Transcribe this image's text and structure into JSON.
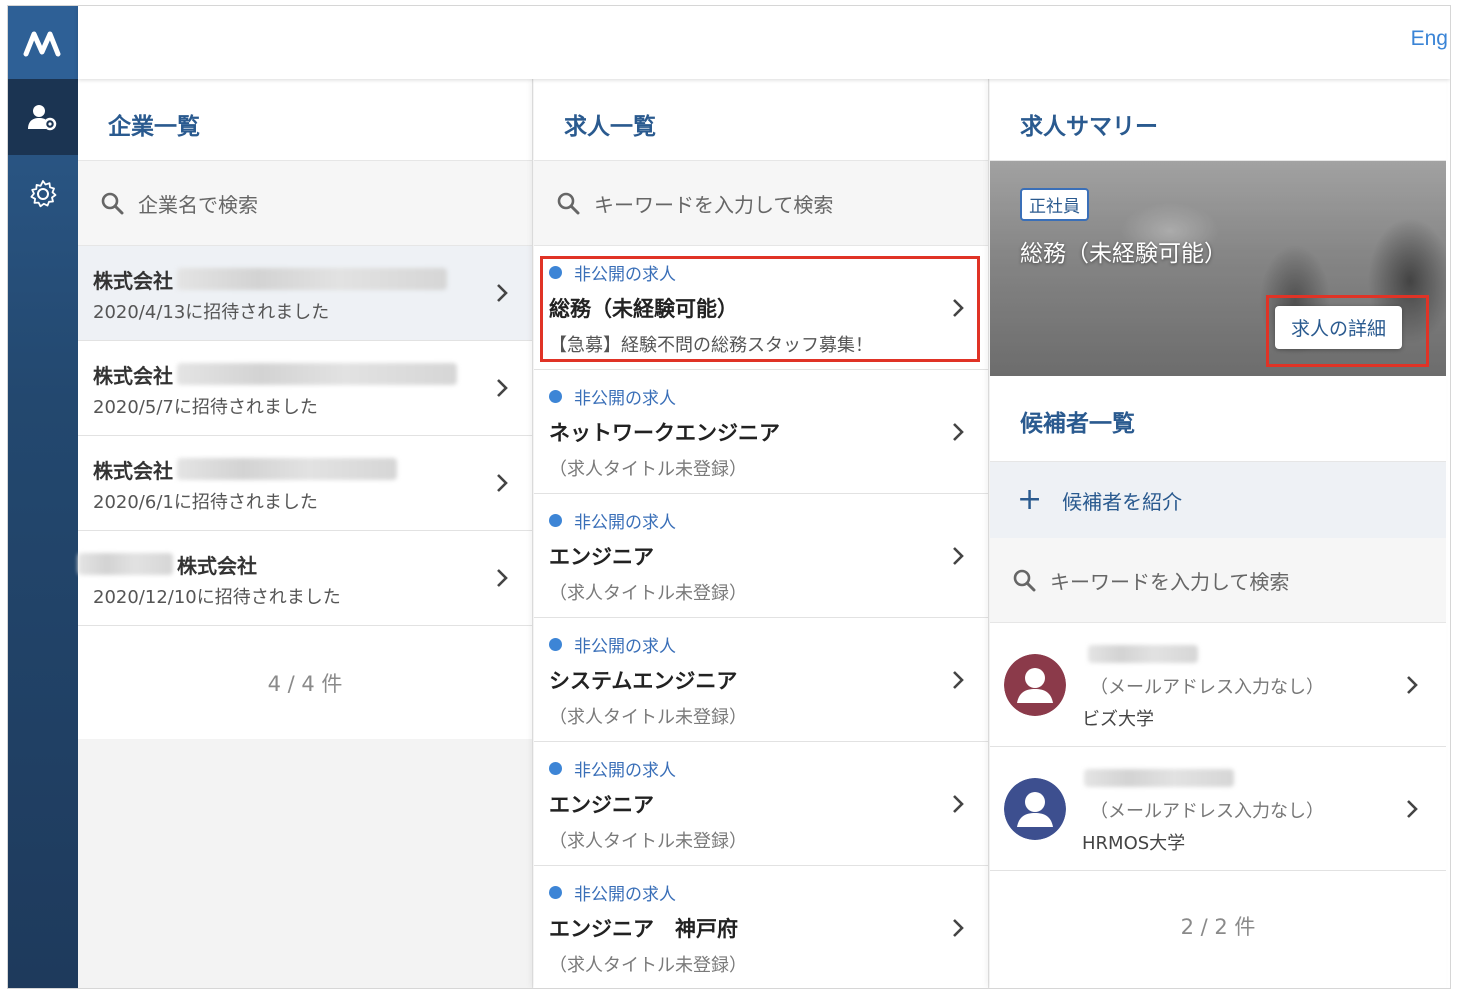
{
  "header": {
    "language_toggle": "Eng"
  },
  "nav": {
    "logo_icon": "brand-logo-icon",
    "items": [
      {
        "icon": "user-settings-icon",
        "active": true
      },
      {
        "icon": "gear-icon",
        "active": false
      }
    ]
  },
  "companies": {
    "title": "企業一覧",
    "search_placeholder": "企業名で検索",
    "items": [
      {
        "name": "株式会社",
        "date": "2020/4/13に招待されました"
      },
      {
        "name": "株式会社",
        "date": "2020/5/7に招待されました"
      },
      {
        "name": "株式会社",
        "date": "2020/6/1に招待されました"
      },
      {
        "name": "株式会社",
        "date": "2020/12/10に招待されました"
      }
    ],
    "count": "4 / 4 件"
  },
  "jobs": {
    "title": "求人一覧",
    "search_placeholder": "キーワードを入力して検索",
    "items": [
      {
        "status": "非公開の求人",
        "title": "総務（未経験可能）",
        "subtitle": "【急募】経験不問の総務スタッフ募集！"
      },
      {
        "status": "非公開の求人",
        "title": "ネットワークエンジニア",
        "subtitle": "（求人タイトル未登録）"
      },
      {
        "status": "非公開の求人",
        "title": "エンジニア",
        "subtitle": "（求人タイトル未登録）"
      },
      {
        "status": "非公開の求人",
        "title": "システムエンジニア",
        "subtitle": "（求人タイトル未登録）"
      },
      {
        "status": "非公開の求人",
        "title": "エンジニア",
        "subtitle": "（求人タイトル未登録）"
      },
      {
        "status": "非公開の求人",
        "title": "エンジニア　神戸府",
        "subtitle": "（求人タイトル未登録）"
      }
    ]
  },
  "summary": {
    "title": "求人サマリー",
    "employment_type": "正社員",
    "job_title": "総務（未経験可能）",
    "detail_button": "求人の詳細"
  },
  "candidates": {
    "title": "候補者一覧",
    "add_label": "候補者を紹介",
    "search_placeholder": "キーワードを入力して検索",
    "items": [
      {
        "email": "（メールアドレス入力なし）",
        "school": "ビズ大学",
        "avatar_color": "#8b3a4a"
      },
      {
        "email": "（メールアドレス入力なし）",
        "school": "HRMOS大学",
        "avatar_color": "#3d4f8f"
      }
    ],
    "count": "2 / 2 件"
  },
  "colors": {
    "accent": "#2a5a8f",
    "link": "#3a84d6",
    "highlight": "#e03326",
    "status_dot": "#3d85d6"
  }
}
